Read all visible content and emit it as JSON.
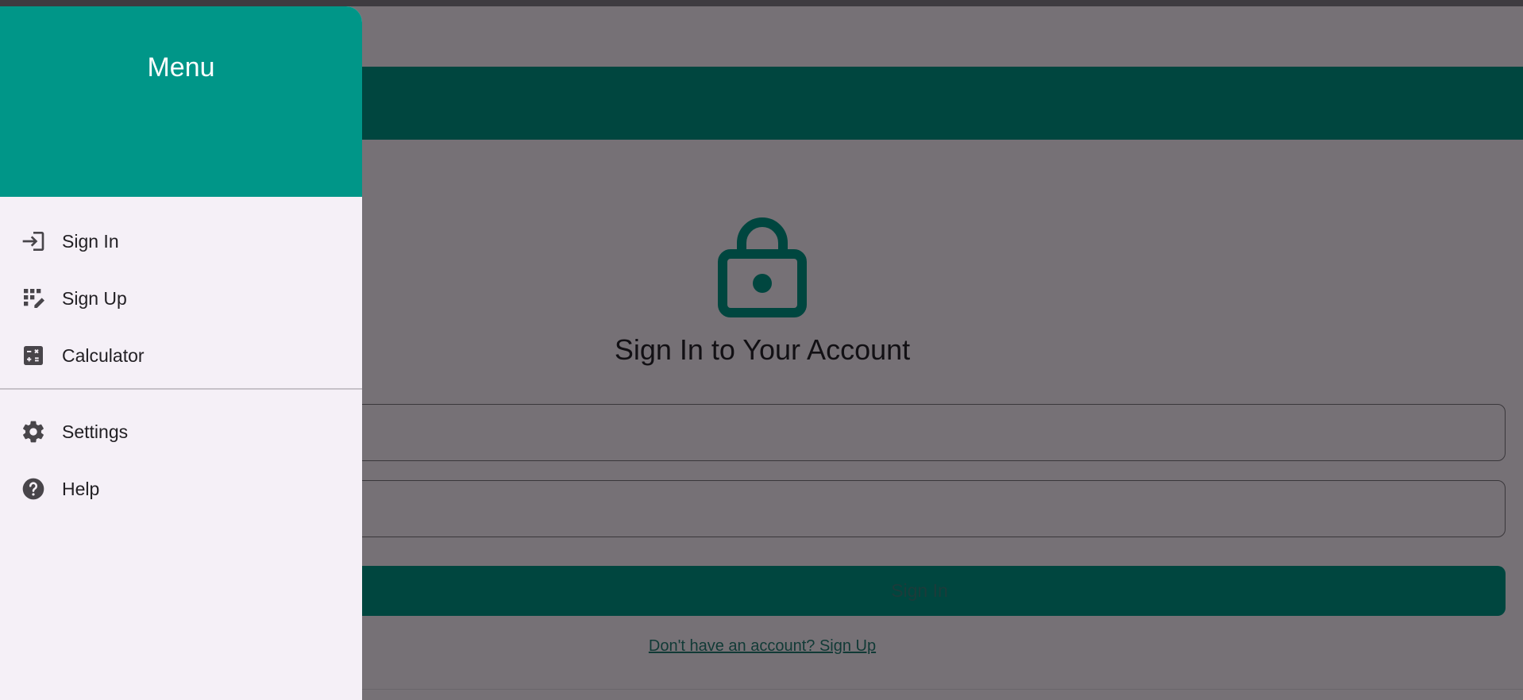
{
  "drawer": {
    "title": "Menu",
    "items": [
      {
        "label": "Sign In",
        "icon": "login-icon"
      },
      {
        "label": "Sign Up",
        "icon": "app-registration-icon"
      },
      {
        "label": "Calculator",
        "icon": "calculate-icon"
      },
      {
        "label": "Settings",
        "icon": "gear-icon"
      },
      {
        "label": "Help",
        "icon": "help-icon"
      }
    ]
  },
  "main": {
    "heading": "Sign In to Your Account",
    "primary_button": "Sign In",
    "signup_link": "Don't have an account? Sign Up"
  },
  "colors": {
    "drawer_header": "#009688",
    "app_bar": "#00463f",
    "scrim": "#767176",
    "drawer_bg": "#f5f0f7"
  }
}
